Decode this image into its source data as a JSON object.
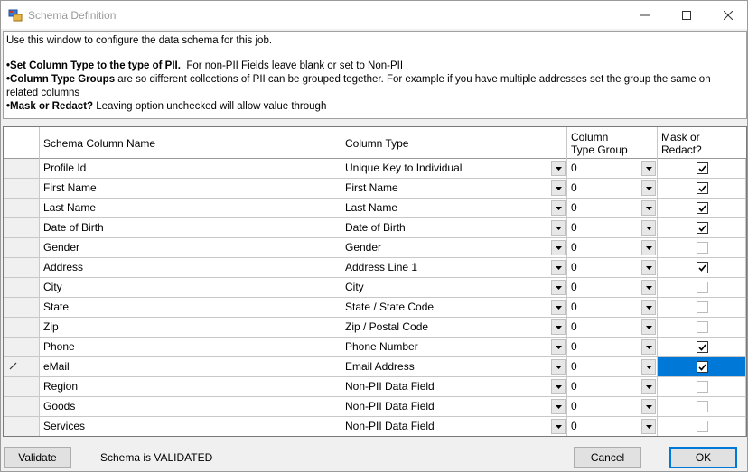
{
  "window": {
    "title": "Schema Definition"
  },
  "info": {
    "line1": "Use this window to configure the data schema for this job.",
    "l2_bold": "•Set Column Type to the type of PII.",
    "l2_rest": "  For non-PII Fields leave blank or set to Non-PII",
    "l3_bold": "•Column Type Groups",
    "l3_rest": " are so different collections of PII can be grouped together. For example if you have multiple addresses set the group the same on related columns",
    "l4_bold": "•Mask or Redact?",
    "l4_rest": " Leaving option unchecked will allow value through"
  },
  "grid": {
    "headers": {
      "name": "Schema Column Name",
      "type": "Column Type",
      "group": "Column\nType Group",
      "mask": "Mask or\nRedact?"
    },
    "rows": [
      {
        "name": "Profile Id",
        "type": "Unique Key to Individual",
        "group": "0",
        "mask": true
      },
      {
        "name": "First Name",
        "type": "First Name",
        "group": "0",
        "mask": true
      },
      {
        "name": "Last Name",
        "type": "Last Name",
        "group": "0",
        "mask": true
      },
      {
        "name": "Date of Birth",
        "type": "Date of Birth",
        "group": "0",
        "mask": true
      },
      {
        "name": "Gender",
        "type": "Gender",
        "group": "0",
        "mask": false
      },
      {
        "name": "Address",
        "type": "Address Line 1",
        "group": "0",
        "mask": true
      },
      {
        "name": "City",
        "type": "City",
        "group": "0",
        "mask": false
      },
      {
        "name": "State",
        "type": "State / State Code",
        "group": "0",
        "mask": false
      },
      {
        "name": "Zip",
        "type": "Zip / Postal Code",
        "group": "0",
        "mask": false
      },
      {
        "name": "Phone",
        "type": "Phone Number",
        "group": "0",
        "mask": true
      },
      {
        "name": "eMail",
        "type": "Email Address",
        "group": "0",
        "mask": true,
        "editing": true
      },
      {
        "name": "Region",
        "type": "Non-PII Data Field",
        "group": "0",
        "mask": false
      },
      {
        "name": "Goods",
        "type": "Non-PII Data Field",
        "group": "0",
        "mask": false
      },
      {
        "name": "Services",
        "type": "Non-PII Data Field",
        "group": "0",
        "mask": false
      }
    ]
  },
  "footer": {
    "validate_label": "Validate",
    "status": "Schema is VALIDATED",
    "cancel_label": "Cancel",
    "ok_label": "OK"
  },
  "colors": {
    "selection": "#0078d7"
  }
}
